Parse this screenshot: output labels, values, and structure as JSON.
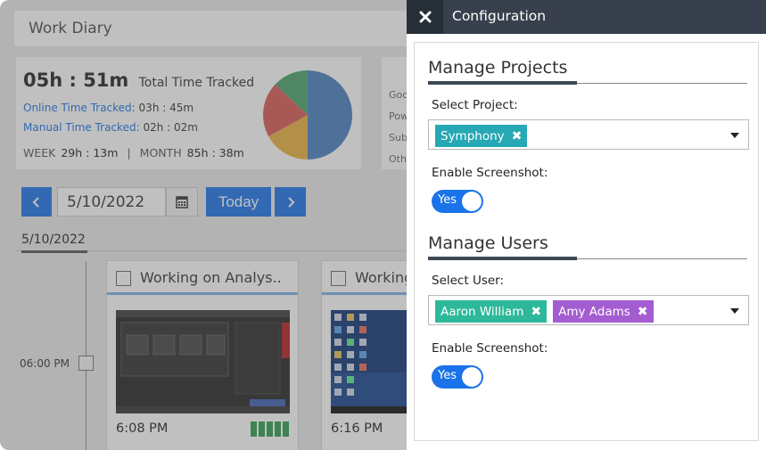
{
  "work_diary": {
    "title": "Work Diary",
    "total_time": "05h : 51m",
    "total_label": "Total Time Tracked",
    "online_label": "Online Time Tracked:",
    "online_value": "03h : 45m",
    "manual_label": "Manual Time Tracked:",
    "manual_value": "02h : 02m",
    "week_label": "WEEK",
    "week_value": "29h : 13m",
    "separator": "|",
    "month_label": "MONTH",
    "month_value": "85h : 38m",
    "side_list": [
      "Goo",
      "Pow",
      "Sub",
      "Oth"
    ],
    "pie_colors": [
      "#4a7fc1",
      "#e8b23c",
      "#d95a55",
      "#4aa36b"
    ],
    "pie_fractions": [
      0.5,
      0.17,
      0.2,
      0.13
    ]
  },
  "date_nav": {
    "prev_icon": "chevron-left-icon",
    "date_value": "5/10/2022",
    "calendar_icon": "calendar-icon",
    "today_label": "Today",
    "next_icon": "chevron-right-icon"
  },
  "day": {
    "label": "5/10/2022",
    "slot_time": "06:00 PM"
  },
  "screenshots": [
    {
      "caption": "Working on Analys..",
      "time": "6:08 PM",
      "activity_fraction": 1.0
    },
    {
      "caption": "Working",
      "time": "6:16 PM"
    }
  ],
  "config": {
    "close_icon": "close-icon",
    "title": "Configuration",
    "projects": {
      "title": "Manage Projects",
      "select_label": "Select Project:",
      "tags": [
        {
          "label": "Symphony",
          "color": "#26a8b5"
        }
      ],
      "screenshot_label": "Enable Screenshot:",
      "toggle_label": "Yes"
    },
    "users": {
      "title": "Manage Users",
      "select_label": "Select User:",
      "tags": [
        {
          "label": "Aaron William",
          "color": "#2eb89a"
        },
        {
          "label": "Amy Adams",
          "color": "#a45dd0"
        }
      ],
      "screenshot_label": "Enable Screenshot:",
      "toggle_label": "Yes"
    },
    "accent_color": "#1a73e8",
    "header_color": "#37404c"
  }
}
